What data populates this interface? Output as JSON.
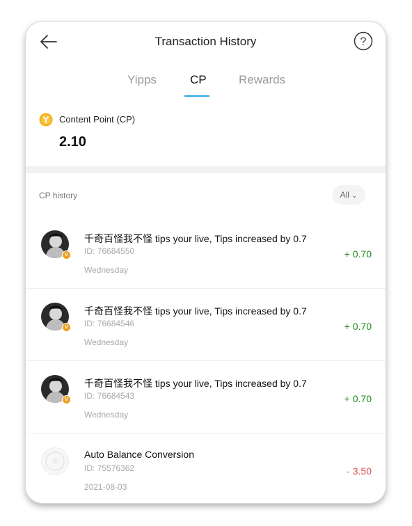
{
  "header": {
    "title": "Transaction History"
  },
  "tabs": [
    {
      "label": "Yipps",
      "active": false
    },
    {
      "label": "CP",
      "active": true
    },
    {
      "label": "Rewards",
      "active": false
    }
  ],
  "summary": {
    "label": "Content Point (CP)",
    "value": "2.10",
    "coin_color": "#f5b21d"
  },
  "history": {
    "label": "CP history",
    "filter": "All"
  },
  "transactions": [
    {
      "description": "千奇百怪我不怪 tips your live, Tips increased by 0.7",
      "id": "ID: 76684550",
      "date": "Wednesday",
      "amount": "+ 0.70"
    },
    {
      "description": "千奇百怪我不怪 tips your live, Tips increased by 0.7",
      "id": "ID: 76684546",
      "date": "Wednesday",
      "amount": "+ 0.70"
    },
    {
      "description": "千奇百怪我不怪 tips your live, Tips increased by 0.7",
      "id": "ID: 76684543",
      "date": "Wednesday",
      "amount": "+ 0.70"
    },
    {
      "description": "Auto Balance Conversion",
      "id": "ID: 75576362",
      "date": "2021-08-03",
      "amount": "- 3.50"
    }
  ],
  "colors": {
    "accent": "#2ba2e6",
    "positive": "#1a8a1a",
    "negative": "#e24a4a"
  }
}
